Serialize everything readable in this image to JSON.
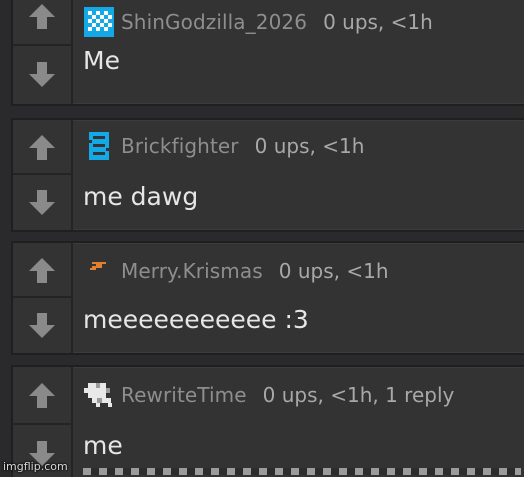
{
  "comments": [
    {
      "username": "ShinGodzilla_2026",
      "meta": "0 ups, <1h",
      "text": "Me",
      "avatar_icon": "blue-pixel-avatar-icon"
    },
    {
      "username": "Brickfighter",
      "meta": "0 ups, <1h",
      "text": "me dawg",
      "avatar_icon": "blue-brick-avatar-icon"
    },
    {
      "username": "Merry.Krismas",
      "meta": "0 ups, <1h",
      "text": "meeeeeeeeeee :3",
      "avatar_icon": "orange-pixel-avatar-icon"
    },
    {
      "username": "RewriteTime",
      "meta": "0 ups, <1h, 1 reply",
      "text": "me",
      "avatar_icon": "white-pixel-avatar-icon"
    }
  ],
  "watermark": "imgflip.com",
  "colors": {
    "background": "#2a2a2c",
    "card": "#333334",
    "arrow": "#8a8a8a",
    "avatar_blue": "#13a9e6",
    "avatar_orange": "#e1802f"
  }
}
